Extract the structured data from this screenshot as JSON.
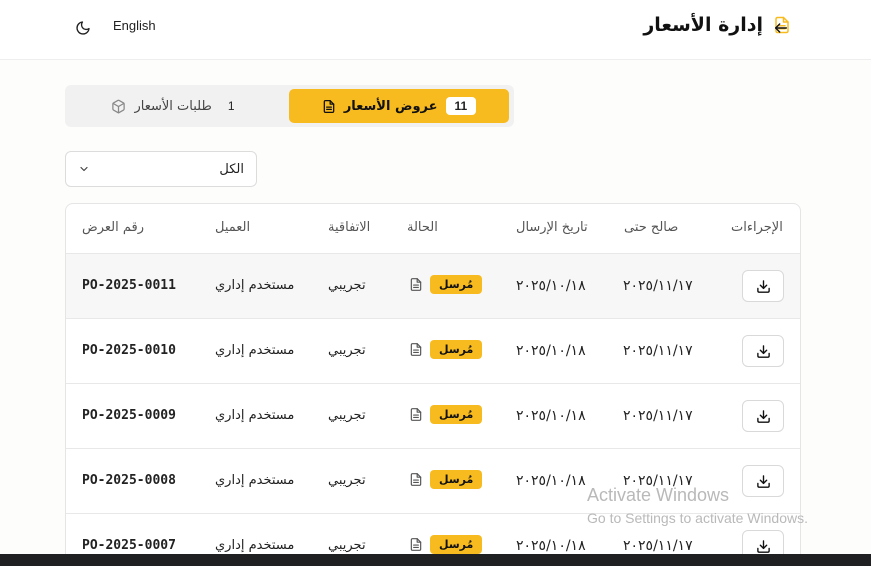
{
  "header": {
    "title": "إدارة الأسعار",
    "language_label": "English"
  },
  "tabs": [
    {
      "label": "عروض الأسعار",
      "count": "11",
      "active": true
    },
    {
      "label": "طلبات الأسعار",
      "count": "1",
      "active": false
    }
  ],
  "filter": {
    "selected": "الكل"
  },
  "table": {
    "columns": [
      "رقم العرض",
      "العميل",
      "الاتفاقية",
      "الحالة",
      "تاريخ الإرسال",
      "صالح حتى",
      "الإجراءات"
    ],
    "rows": [
      {
        "id": "PO-2025-0011",
        "client": "مستخدم إداري",
        "agreement": "تجريبي",
        "status": "مُرسل",
        "sent": "٢٠٢٥/١٠/١٨",
        "valid": "٢٠٢٥/١١/١٧"
      },
      {
        "id": "PO-2025-0010",
        "client": "مستخدم إداري",
        "agreement": "تجريبي",
        "status": "مُرسل",
        "sent": "٢٠٢٥/١٠/١٨",
        "valid": "٢٠٢٥/١١/١٧"
      },
      {
        "id": "PO-2025-0009",
        "client": "مستخدم إداري",
        "agreement": "تجريبي",
        "status": "مُرسل",
        "sent": "٢٠٢٥/١٠/١٨",
        "valid": "٢٠٢٥/١١/١٧"
      },
      {
        "id": "PO-2025-0008",
        "client": "مستخدم إداري",
        "agreement": "تجريبي",
        "status": "مُرسل",
        "sent": "٢٠٢٥/١٠/١٨",
        "valid": "٢٠٢٥/١١/١٧"
      },
      {
        "id": "PO-2025-0007",
        "client": "مستخدم إداري",
        "agreement": "تجريبي",
        "status": "مُرسل",
        "sent": "٢٠٢٥/١٠/١٨",
        "valid": "٢٠٢٥/١١/١٧"
      }
    ]
  },
  "watermark": {
    "line1": "Activate Windows",
    "line2": "Go to Settings to activate Windows."
  },
  "colors": {
    "accent": "#f8bb1f"
  },
  "icons": {
    "theme": "moon-icon",
    "back": "arrow-left-icon",
    "title": "document-icon",
    "tab_quotes": "document-icon",
    "tab_requests": "box-icon",
    "filter": "chevron-down-icon",
    "row_status": "document-icon",
    "row_action": "download-icon"
  }
}
